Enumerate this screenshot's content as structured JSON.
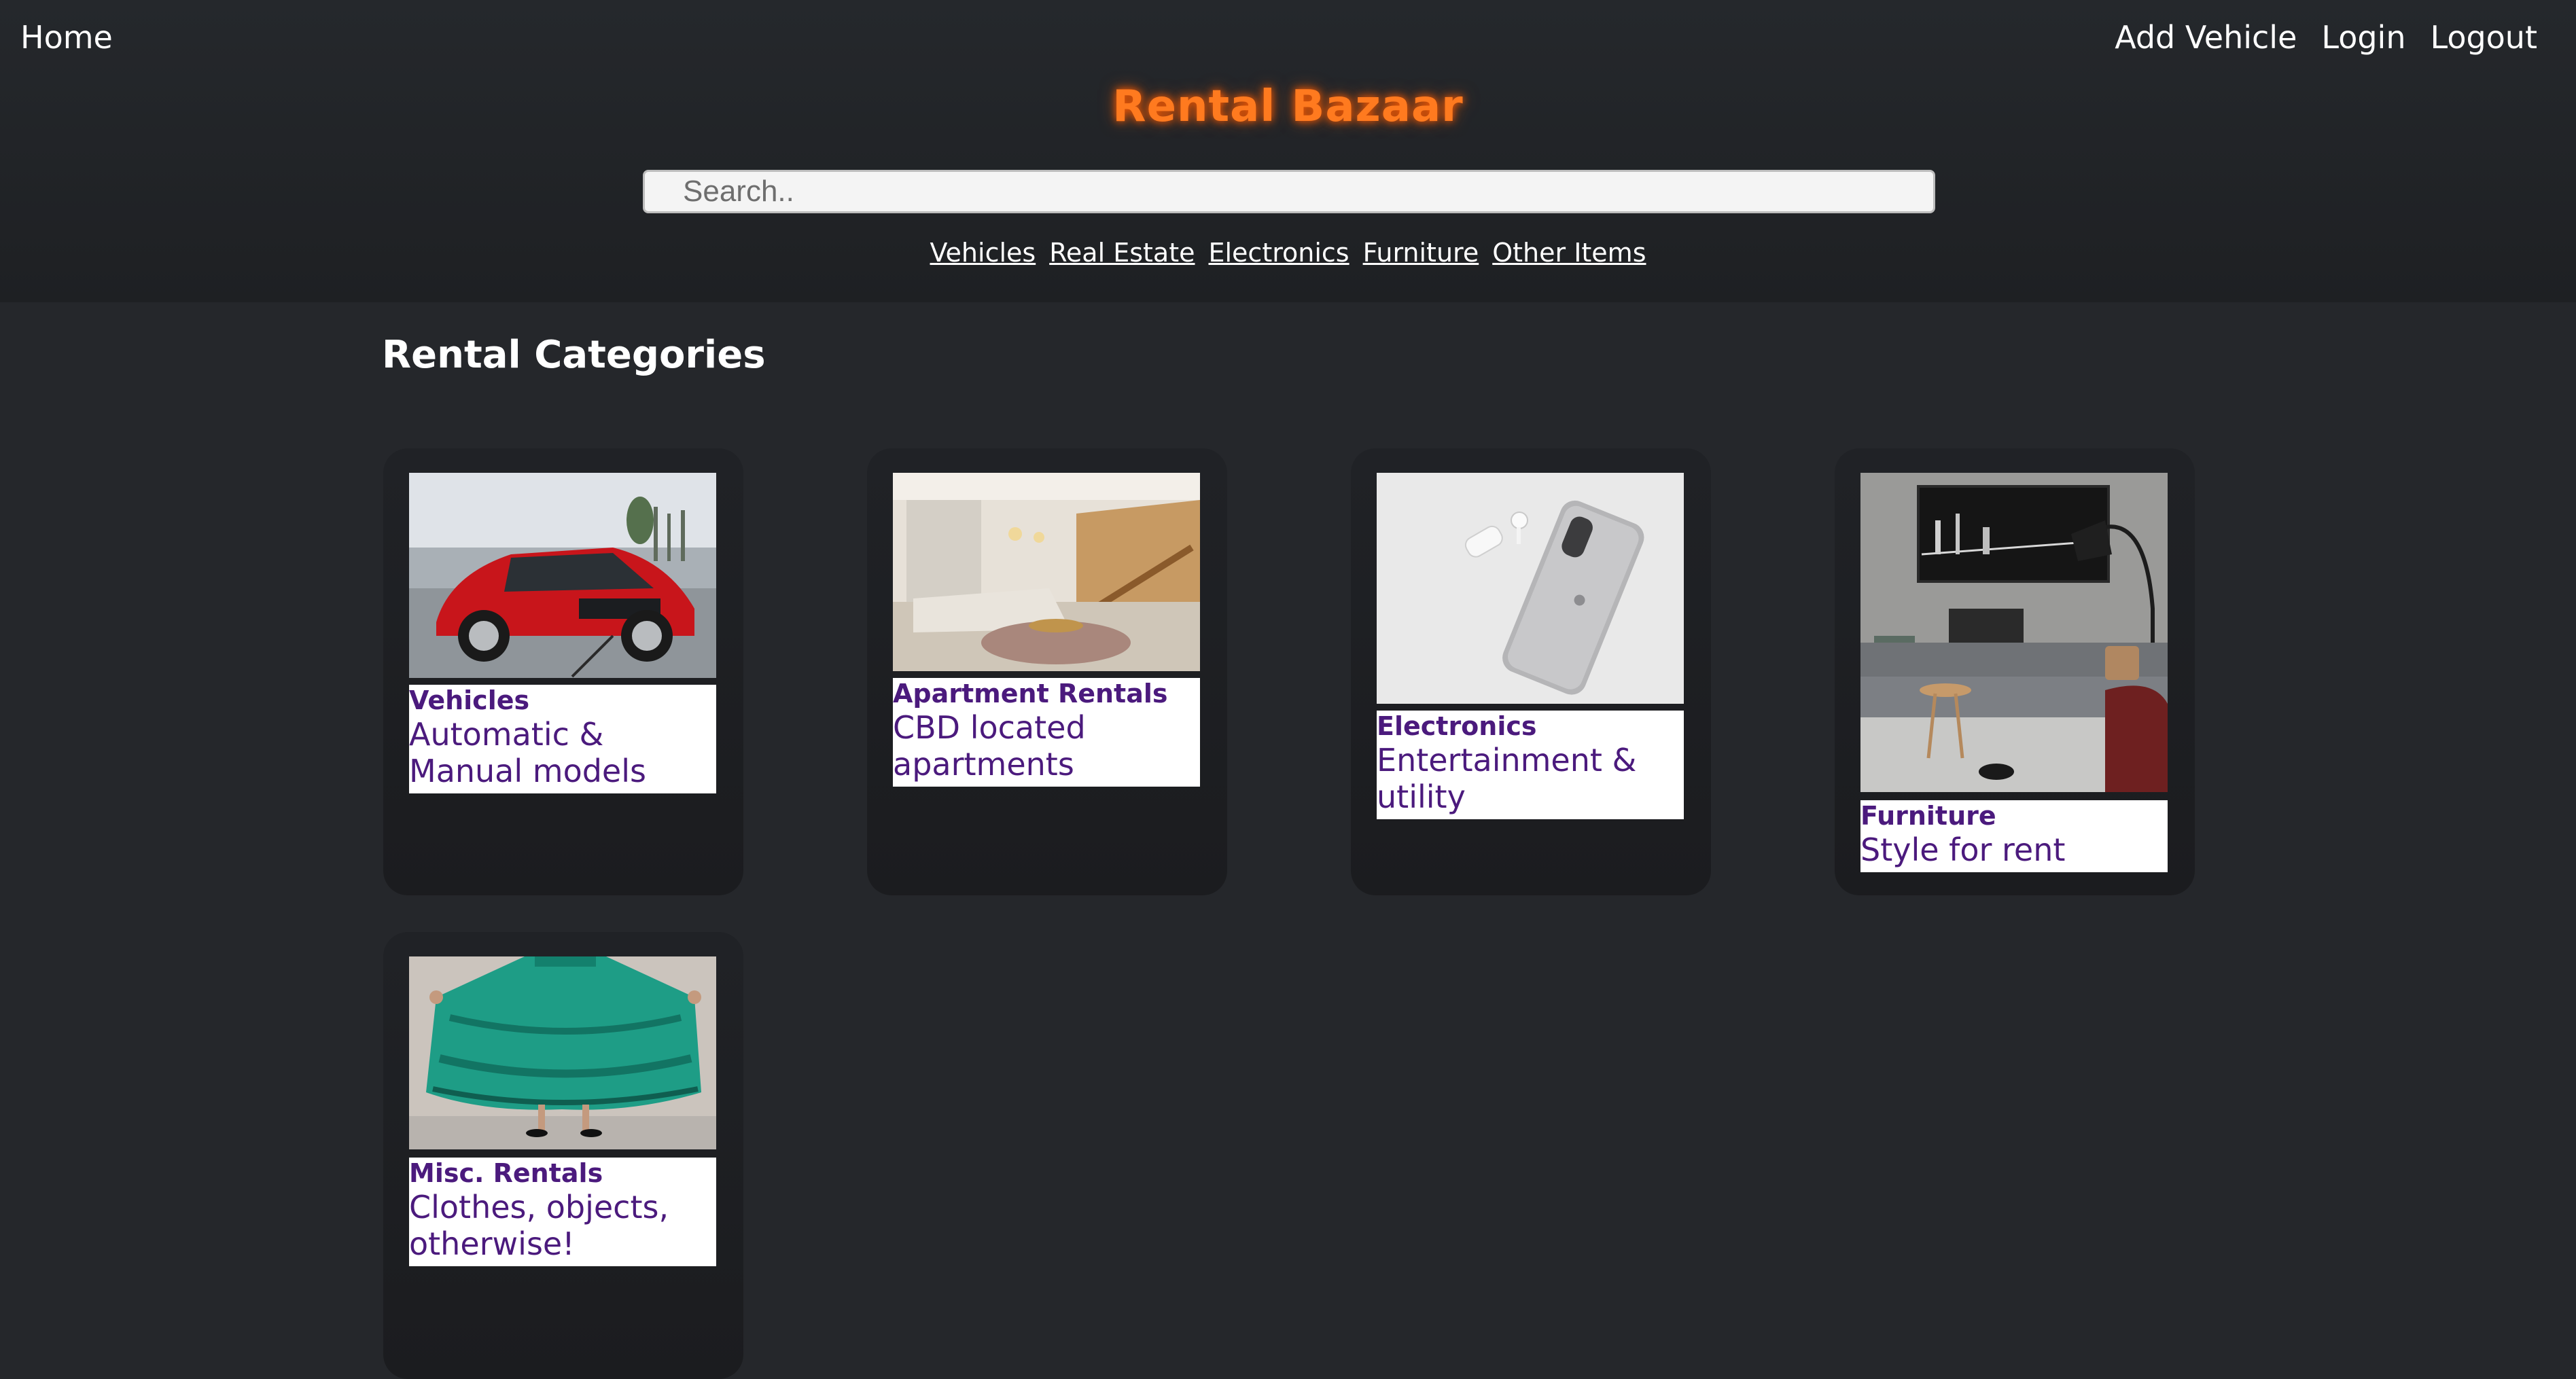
{
  "nav": {
    "home": "Home",
    "right": [
      "Add Vehicle",
      "Login",
      "Logout"
    ]
  },
  "site": {
    "title": "Rental Bazaar",
    "title_color": "#ff7a1f"
  },
  "search": {
    "placeholder": "Search..",
    "value": ""
  },
  "category_links": [
    "Vehicles",
    "Real Estate",
    "Electronics",
    "Furniture",
    "Other Items"
  ],
  "section": {
    "title": "Rental Categories"
  },
  "cards": [
    {
      "name": "Vehicles",
      "desc": "Automatic & Manual models",
      "image": "red-car-image"
    },
    {
      "name": "Apartment Rentals",
      "desc": "CBD located apartments",
      "image": "living-room-image"
    },
    {
      "name": "Electronics",
      "desc": "Entertainment & utility",
      "image": "phone-earbuds-image"
    },
    {
      "name": "Furniture",
      "desc": "Style for rent",
      "image": "sofa-room-image"
    },
    {
      "name": "Misc. Rentals",
      "desc": "Clothes, objects, otherwise!",
      "image": "green-dress-image"
    }
  ],
  "colors": {
    "background": "#25272b",
    "card_text": "#4b1a7d"
  }
}
